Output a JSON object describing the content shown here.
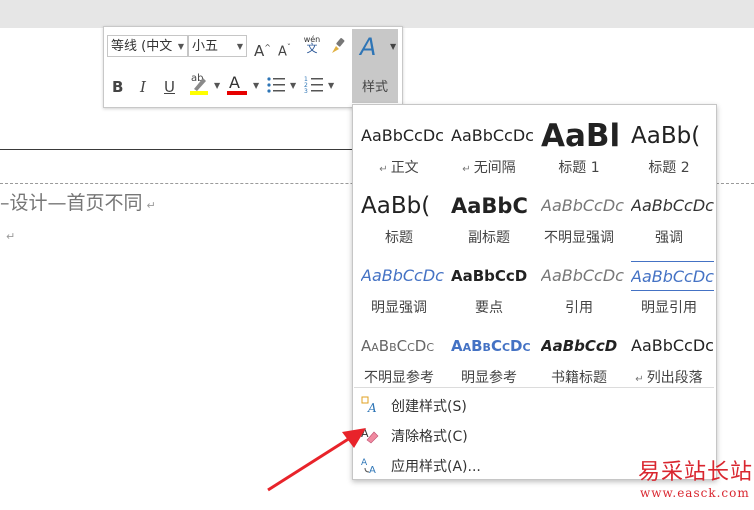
{
  "document": {
    "heading_text": "–设计—首页不同",
    "paragraph_mark": "↵"
  },
  "mini_toolbar": {
    "font_name": "等线 (中文",
    "font_size": "小五",
    "grow_font_label": "A",
    "shrink_font_label": "A",
    "phonetic_top": "wén",
    "phonetic_bottom": "文",
    "bold_label": "B",
    "italic_label": "I",
    "underline_label": "U",
    "highlight_label": "ab",
    "font_color_label": "A",
    "styles_button_label": "样式",
    "highlight_color": "#ffff00",
    "font_color": "#e60000"
  },
  "styles_gallery": {
    "styles": [
      {
        "preview": "AaBbCcDc",
        "name": "正文",
        "mark": "↵"
      },
      {
        "preview": "AaBbCcDc",
        "name": "无间隔",
        "mark": "↵"
      },
      {
        "preview": "AaBl",
        "name": "标题 1",
        "mark": ""
      },
      {
        "preview": "AaBb(",
        "name": "标题 2",
        "mark": ""
      },
      {
        "preview": "AaBb(",
        "name": "标题",
        "mark": ""
      },
      {
        "preview": "AaBbC",
        "name": "副标题",
        "mark": ""
      },
      {
        "preview": "AaBbCcDc",
        "name": "不明显强调",
        "mark": ""
      },
      {
        "preview": "AaBbCcDc",
        "name": "强调",
        "mark": ""
      },
      {
        "preview": "AaBbCcDc",
        "name": "明显强调",
        "mark": ""
      },
      {
        "preview": "AaBbCcD",
        "name": "要点",
        "mark": ""
      },
      {
        "preview": "AaBbCcDc",
        "name": "引用",
        "mark": ""
      },
      {
        "preview": "AaBbCcDc",
        "name": "明显引用",
        "mark": ""
      },
      {
        "preview": "AaBbCcDc",
        "name": "不明显参考",
        "mark": ""
      },
      {
        "preview": "AaBbCcDc",
        "name": "明显参考",
        "mark": ""
      },
      {
        "preview": "AaBbCcD",
        "name": "书籍标题",
        "mark": ""
      },
      {
        "preview": "AaBbCcDc",
        "name": "列出段落",
        "mark": "↵"
      }
    ],
    "menu_items": [
      {
        "label": "创建样式(S)",
        "icon": "create-style-icon"
      },
      {
        "label": "清除格式(C)",
        "icon": "clear-formatting-icon"
      },
      {
        "label": "应用样式(A)...",
        "icon": "apply-styles-icon"
      }
    ],
    "accent_blue": "#4472c4"
  },
  "watermark": {
    "name": "易采站长站",
    "url": "www.easck.com"
  }
}
